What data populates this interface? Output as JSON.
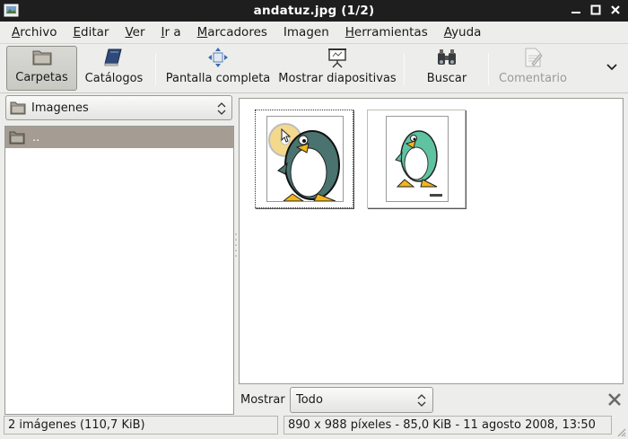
{
  "window": {
    "title": "andatuz.jpg  (1/2)"
  },
  "menubar": {
    "items": [
      {
        "label": "Archivo",
        "mnemonic": "A",
        "rest": "rchivo"
      },
      {
        "label": "Editar",
        "mnemonic": "E",
        "rest": "ditar"
      },
      {
        "label": "Ver",
        "mnemonic": "V",
        "rest": "er"
      },
      {
        "label": "Ir a",
        "mnemonic": "I",
        "rest": "r a"
      },
      {
        "label": "Marcadores",
        "mnemonic": "M",
        "rest": "arcadores"
      },
      {
        "label": "Imagen",
        "mnemonic": "",
        "rest": "Imagen"
      },
      {
        "label": "Herramientas",
        "mnemonic": "H",
        "rest": "erramientas"
      },
      {
        "label": "Ayuda",
        "mnemonic": "A",
        "rest": "yuda"
      }
    ]
  },
  "toolbar": {
    "folders_label": "Carpetas",
    "catalogs_label": "Catálogos",
    "fullscreen_label": "Pantalla completa",
    "slideshow_label": "Mostrar diapositivas",
    "search_label": "Buscar",
    "comment_label": "Comentario"
  },
  "sidebar": {
    "location": "Imagenes",
    "rows": [
      ".."
    ]
  },
  "filter": {
    "label": "Mostrar",
    "value": "Todo"
  },
  "status": {
    "left": "2 imágenes (110,7 KiB)",
    "right": "890 x 988 píxeles - 85,0 KiB - 11 agosto 2008, 13:50"
  },
  "colors": {
    "selection": "#a59d93",
    "penguin_dark": "#4a7370",
    "penguin_light": "#5fc3a2",
    "beak": "#f2b51c"
  }
}
